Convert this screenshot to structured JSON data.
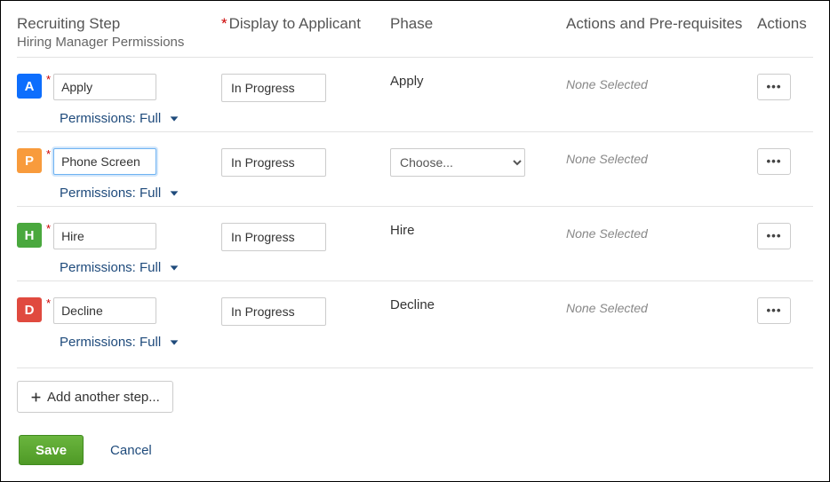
{
  "headers": {
    "step": "Recruiting Step",
    "step_sub": "Hiring Manager Permissions",
    "display": "Display to Applicant",
    "phase": "Phase",
    "prereq": "Actions and Pre-requisites",
    "actions": "Actions"
  },
  "rows": [
    {
      "badge": "A",
      "badge_class": "badge-blue",
      "name": "Apply",
      "focused": false,
      "display": "In Progress",
      "phase_type": "static",
      "phase_value": "Apply",
      "prereq": "None Selected",
      "permissions": "Permissions: Full"
    },
    {
      "badge": "P",
      "badge_class": "badge-orange",
      "name": "Phone Screen",
      "focused": true,
      "display": "In Progress",
      "phase_type": "select",
      "phase_value": "Choose...",
      "prereq": "None Selected",
      "permissions": "Permissions: Full"
    },
    {
      "badge": "H",
      "badge_class": "badge-green",
      "name": "Hire",
      "focused": false,
      "display": "In Progress",
      "phase_type": "static",
      "phase_value": "Hire",
      "prereq": "None Selected",
      "permissions": "Permissions: Full"
    },
    {
      "badge": "D",
      "badge_class": "badge-red",
      "name": "Decline",
      "focused": false,
      "display": "In Progress",
      "phase_type": "static",
      "phase_value": "Decline",
      "prereq": "None Selected",
      "permissions": "Permissions: Full"
    }
  ],
  "add_step": "Add another step...",
  "footer": {
    "save": "Save",
    "cancel": "Cancel"
  }
}
